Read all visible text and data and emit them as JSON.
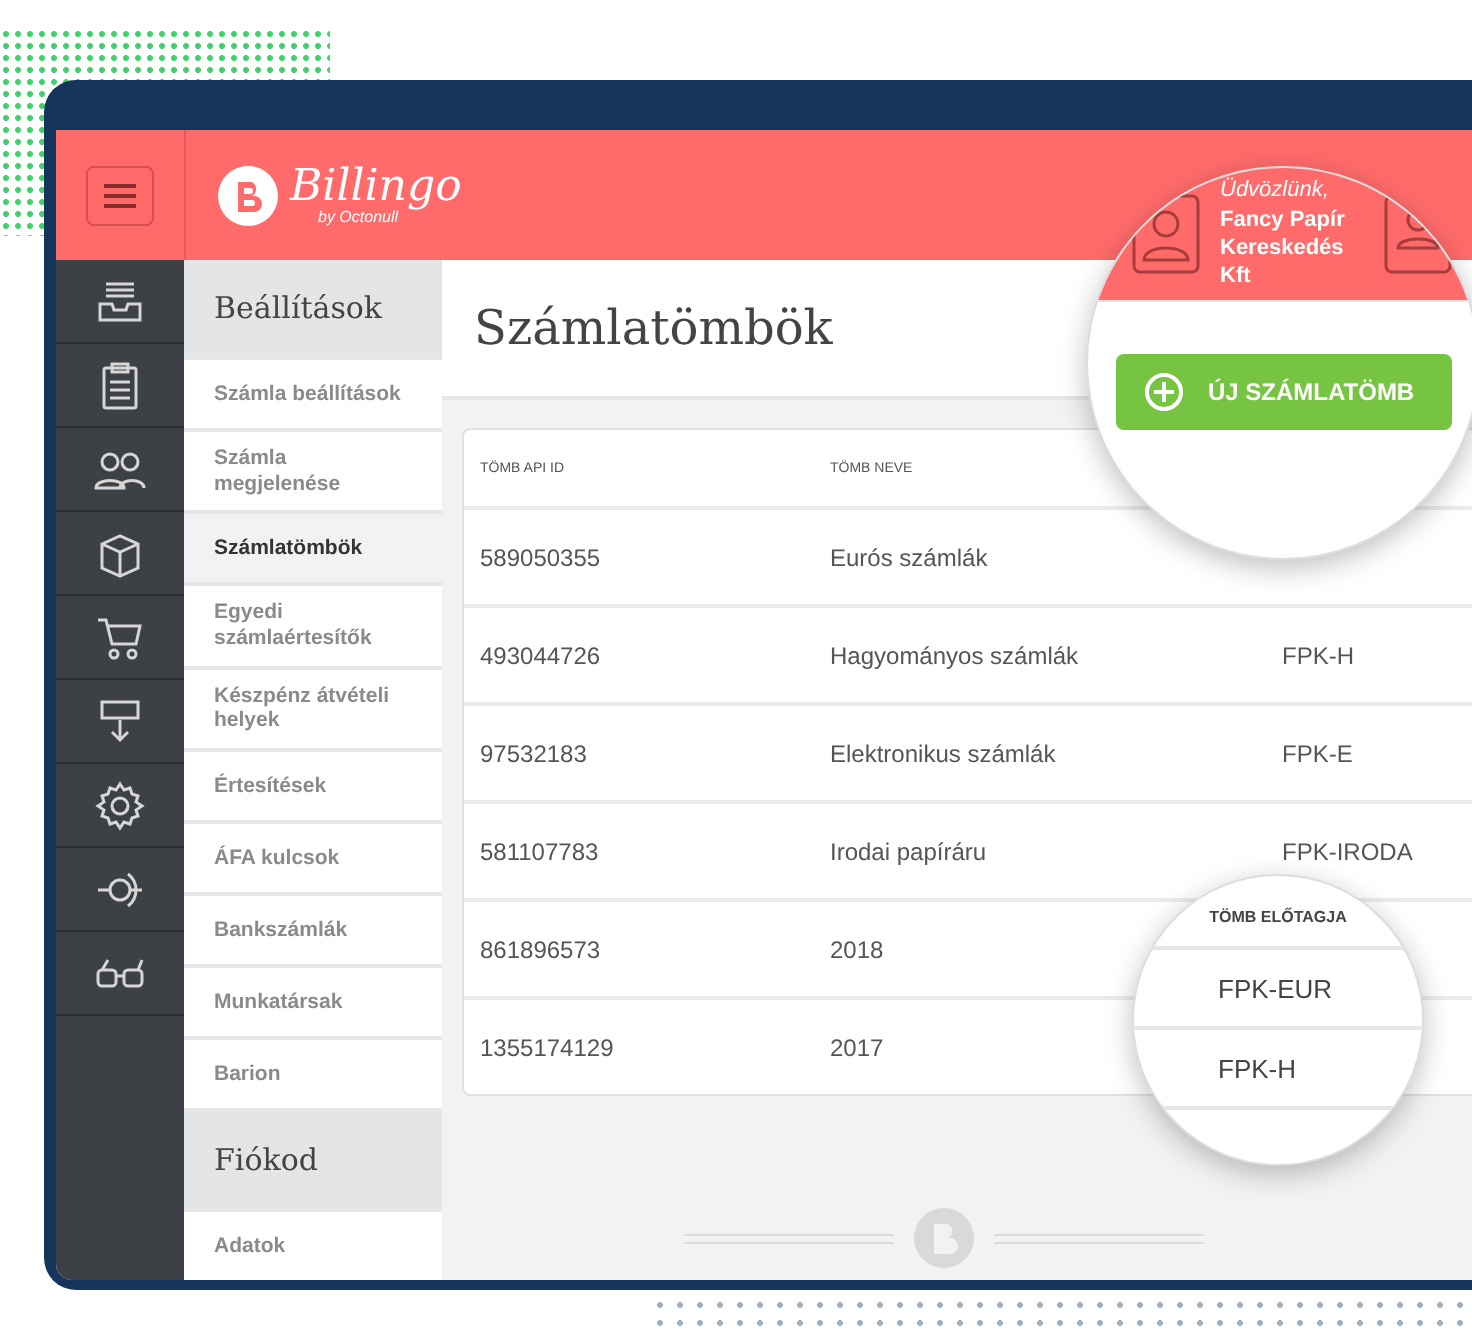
{
  "header": {
    "logo": "Billingo",
    "logo_sub": "by Octonull"
  },
  "settings_menu": [
    {
      "kind": "heading",
      "label": "Beállítások"
    },
    {
      "kind": "item",
      "label": "Számla beállítások",
      "selected": false
    },
    {
      "kind": "item",
      "label": "Számla megjelenése",
      "selected": false
    },
    {
      "kind": "item",
      "label": "Számlatömbök",
      "selected": true
    },
    {
      "kind": "item",
      "label": "Egyedi számlaértesítők",
      "selected": false
    },
    {
      "kind": "item",
      "label": "Készpénz átvételi helyek",
      "selected": false
    },
    {
      "kind": "item",
      "label": "Értesítések",
      "selected": false
    },
    {
      "kind": "item",
      "label": "ÁFA kulcsok",
      "selected": false
    },
    {
      "kind": "item",
      "label": "Bankszámlák",
      "selected": false
    },
    {
      "kind": "item",
      "label": "Munkatársak",
      "selected": false
    },
    {
      "kind": "item",
      "label": "Barion",
      "selected": false
    },
    {
      "kind": "heading",
      "label": "Fiókod"
    },
    {
      "kind": "item",
      "label": "Adatok",
      "selected": false
    }
  ],
  "page_title": "Számlatömbök",
  "table": {
    "columns": [
      "TÖMB API ID",
      "TÖMB NEVE"
    ],
    "rows": [
      {
        "api_id": "589050355",
        "name": "Eurós számlák"
      },
      {
        "api_id": "493044726",
        "name": "Hagyományos számlák",
        "prefix": "FPK-H"
      },
      {
        "api_id": "97532183",
        "name": "Elektronikus számlák",
        "prefix": "FPK-E"
      },
      {
        "api_id": "581107783",
        "name": "Irodai papíráru",
        "prefix": "FPK-IRODA"
      },
      {
        "api_id": "861896573",
        "name": "2018"
      },
      {
        "api_id": "1355174129",
        "name": "2017"
      }
    ]
  },
  "magnifier_top": {
    "greeting": "Üdvözlünk,",
    "user": "Fancy Papír Kereskedés Kft",
    "button": "ÚJ SZÁMLATÖMB"
  },
  "magnifier_bottom": {
    "header": "TÖMB ELŐTAGJA",
    "values": [
      "FPK-EUR",
      "FPK-H"
    ]
  }
}
